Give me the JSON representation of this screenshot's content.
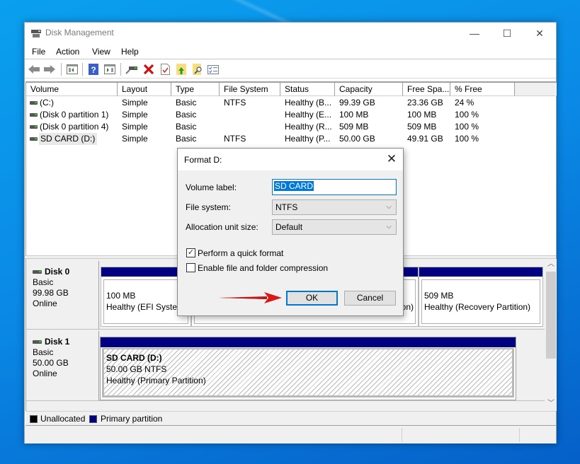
{
  "window": {
    "title": "Disk Management",
    "controls": {
      "minimize": "—",
      "maximize": "☐",
      "close": "✕"
    }
  },
  "menu": [
    "File",
    "Action",
    "View",
    "Help"
  ],
  "toolbar": {
    "icons": [
      "back-icon",
      "forward-icon",
      "show-hide-console-tree-icon",
      "help-icon",
      "show-action-pane-icon",
      "connect-drive-icon",
      "delete-icon",
      "properties-icon",
      "export-icon",
      "find-icon",
      "checklist-icon"
    ]
  },
  "volume_list": {
    "columns": [
      "Volume",
      "Layout",
      "Type",
      "File System",
      "Status",
      "Capacity",
      "Free Spa...",
      "% Free"
    ],
    "rows": [
      {
        "volume": " (C:)",
        "layout": "Simple",
        "type": "Basic",
        "fs": "NTFS",
        "status": "Healthy (B...",
        "capacity": "99.39 GB",
        "free": "23.36 GB",
        "pct": "24 %"
      },
      {
        "volume": "(Disk 0 partition 1)",
        "layout": "Simple",
        "type": "Basic",
        "fs": "",
        "status": "Healthy (E...",
        "capacity": "100 MB",
        "free": "100 MB",
        "pct": "100 %"
      },
      {
        "volume": "(Disk 0 partition 4)",
        "layout": "Simple",
        "type": "Basic",
        "fs": "",
        "status": "Healthy (R...",
        "capacity": "509 MB",
        "free": "509 MB",
        "pct": "100 %"
      },
      {
        "volume": "SD CARD (D:)",
        "layout": "Simple",
        "type": "Basic",
        "fs": "NTFS",
        "status": "Healthy (P...",
        "capacity": "50.00 GB",
        "free": "49.91 GB",
        "pct": "100 %"
      }
    ]
  },
  "disks": [
    {
      "name": "Disk 0",
      "type": "Basic",
      "size": "99.98 GB",
      "state": "Online",
      "partitions": [
        {
          "size": "100 MB",
          "status": "Healthy (EFI System Partition)"
        },
        {
          "size": "",
          "status": "Healthy (Boot, Page File, Crash Dump, Primary Partition)"
        },
        {
          "size": "509 MB",
          "status": "Healthy (Recovery Partition)"
        }
      ]
    },
    {
      "name": "Disk 1",
      "type": "Basic",
      "size": "50.00 GB",
      "state": "Online",
      "partitions": [
        {
          "label": "SD CARD  (D:)",
          "size": "50.00 GB NTFS",
          "status": "Healthy (Primary Partition)"
        }
      ]
    }
  ],
  "legend": [
    {
      "label": "Unallocated",
      "color": "#000000"
    },
    {
      "label": "Primary partition",
      "color": "#000080"
    }
  ],
  "dialog": {
    "title": "Format D:",
    "volume_label_label": "Volume label:",
    "volume_label_value": "SD CARD",
    "file_system_label": "File system:",
    "file_system_value": "NTFS",
    "alloc_label": "Allocation unit size:",
    "alloc_value": "Default",
    "quick_format_label": "Perform a quick format",
    "quick_format_checked": true,
    "compression_label": "Enable file and folder compression",
    "compression_checked": false,
    "ok_label": "OK",
    "cancel_label": "Cancel"
  },
  "annotation": {
    "arrow_color": "#d61a1a",
    "points_to": "OK"
  }
}
